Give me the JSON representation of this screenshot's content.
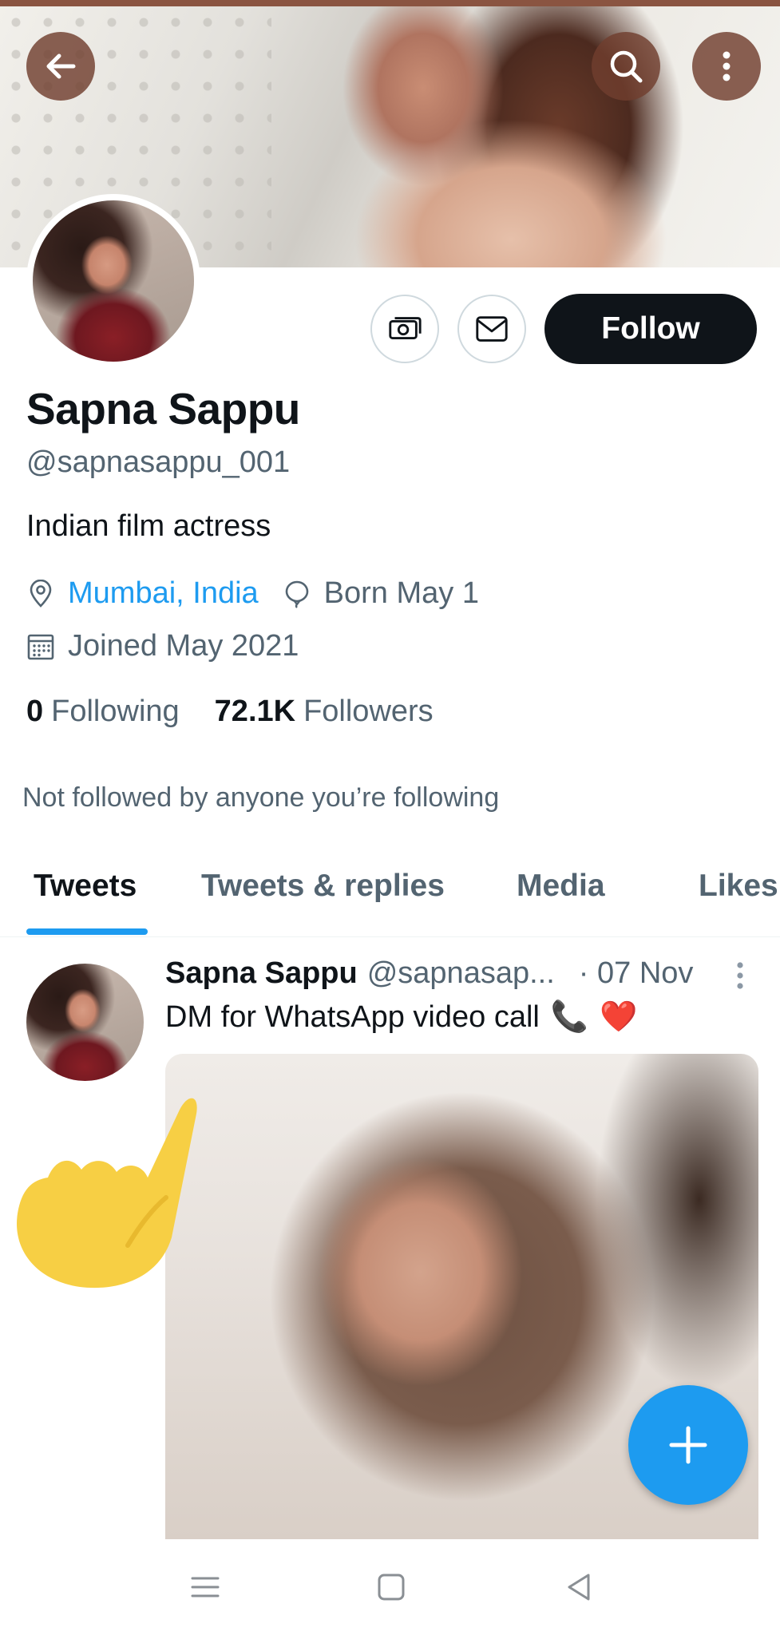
{
  "profile": {
    "name": "Sapna Sappu",
    "handle": "@sapnasappu_001",
    "bio": "Indian film actress",
    "location": "Mumbai, India",
    "birthday": "Born May 1",
    "joined": "Joined May 2021",
    "following_count": "0",
    "following_label": "Following",
    "followers_count": "72.1K",
    "followers_label": "Followers",
    "not_followed_text": "Not followed by anyone you’re following"
  },
  "actions": {
    "follow_label": "Follow"
  },
  "tabs": [
    {
      "label": "Tweets",
      "active": true
    },
    {
      "label": "Tweets & replies",
      "active": false
    },
    {
      "label": "Media",
      "active": false
    },
    {
      "label": "Likes",
      "active": false
    }
  ],
  "tweet": {
    "name": "Sapna Sappu",
    "handle": "@sapnasap...",
    "date": "· 07 Nov",
    "text": "DM for WhatsApp video call",
    "emojis": [
      "📞",
      "❤️"
    ]
  },
  "icons": {
    "back": "arrow-left-icon",
    "search": "search-icon",
    "more": "more-vertical-icon",
    "tip": "money-icon",
    "message": "envelope-icon",
    "location": "location-pin-icon",
    "birthday": "balloon-icon",
    "joined": "calendar-icon",
    "compose": "plus-icon"
  },
  "colors": {
    "accent": "#1d9bf0",
    "follow_button": "#0f1419",
    "secondary_text": "#536471"
  }
}
